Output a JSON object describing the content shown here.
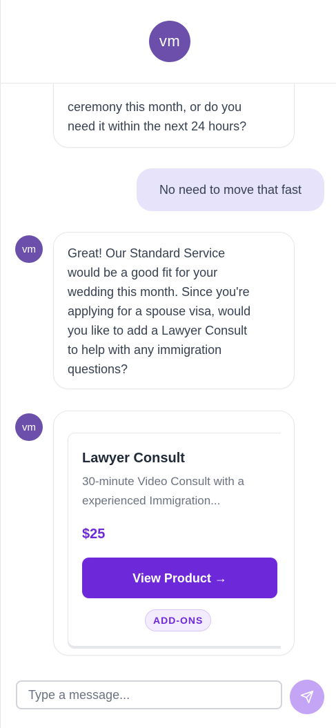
{
  "header": {
    "avatar_initials": "vm"
  },
  "messages": {
    "prev_bot": {
      "lines": [
        "ceremony this month, or do you",
        "need it within the next 24 hours?"
      ]
    },
    "user": {
      "text": "No need to move that fast"
    },
    "bot_reply": {
      "avatar_initials": "vm",
      "lines": [
        "Great! Our Standard Service",
        "would be a good fit for your",
        "wedding this month. Since you're",
        "applying for a spouse visa, would",
        "you like to add a Lawyer Consult",
        "to help with any immigration",
        "questions?"
      ]
    },
    "product_message": {
      "avatar_initials": "vm",
      "product": {
        "title": "Lawyer Consult",
        "description_lines": [
          "30-minute Video Consult with a",
          "experienced Immigration..."
        ],
        "price": "$25",
        "button_label": "View Product →",
        "tag": "ADD-ONS"
      }
    }
  },
  "composer": {
    "placeholder": "Type a message...",
    "value": "",
    "send_icon": "send-icon"
  },
  "colors": {
    "brand_avatar": "#6b4faa",
    "accent": "#6d28d9",
    "user_bubble": "#e6e3fb",
    "send_button": "#c4a4f5"
  }
}
